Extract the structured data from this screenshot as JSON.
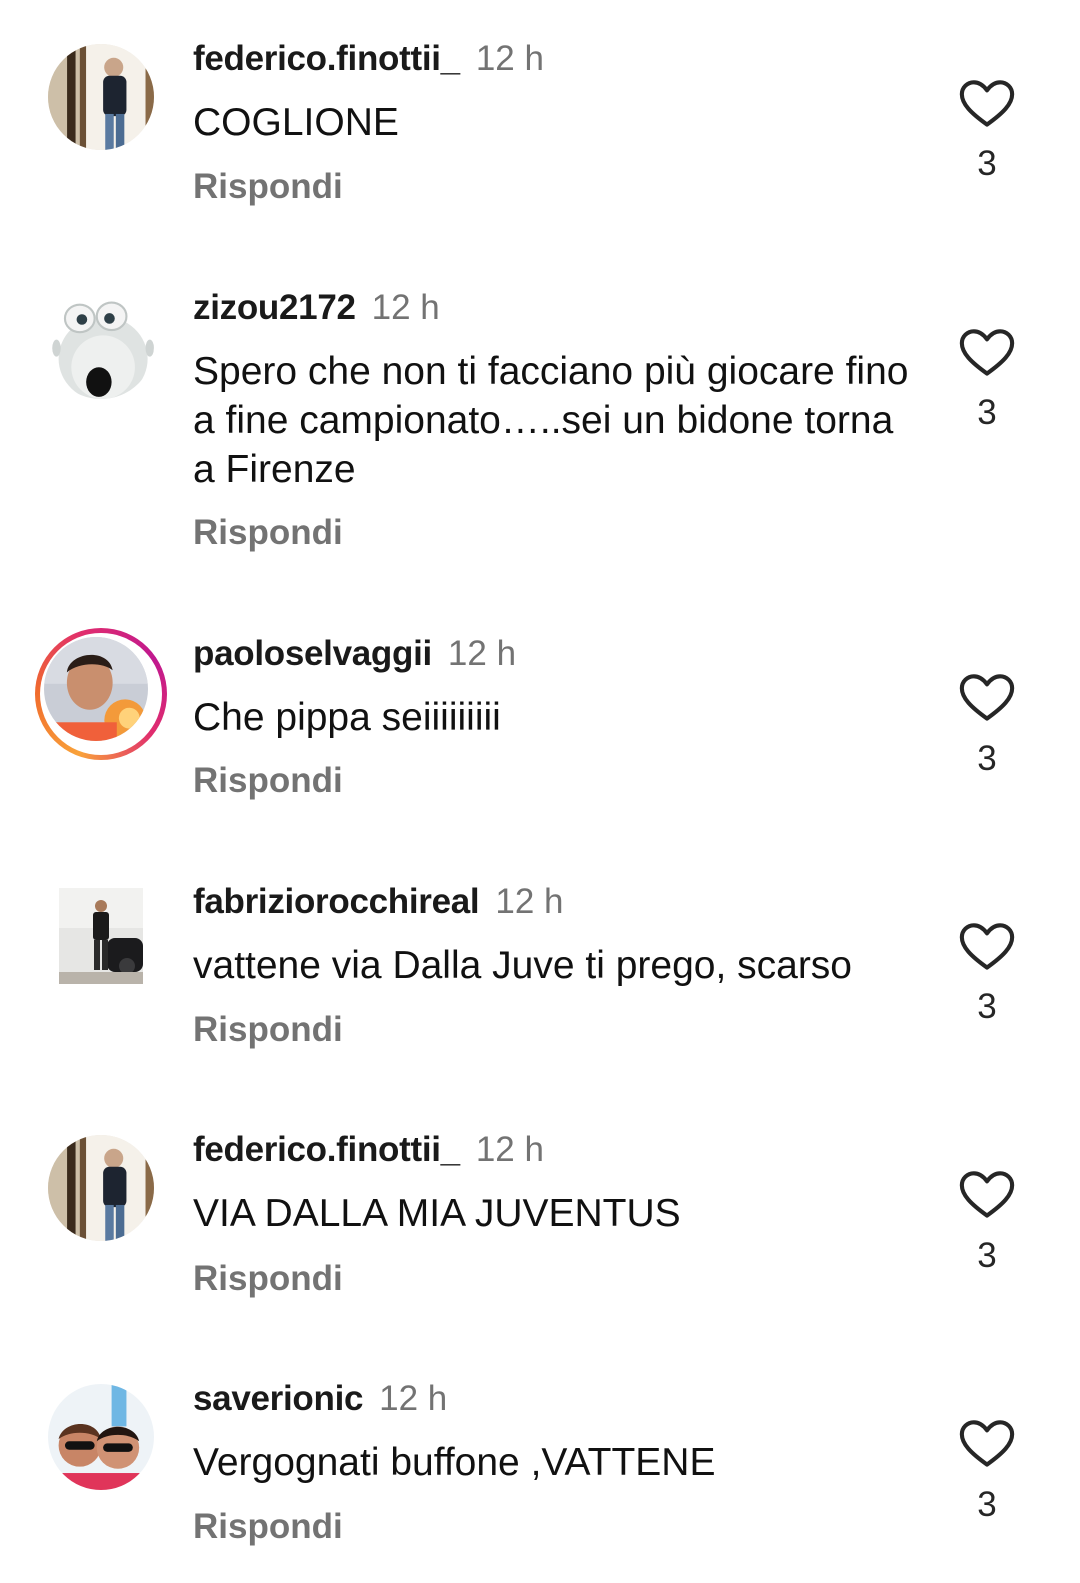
{
  "comments": [
    {
      "username": "federico.finottii_",
      "time": "12 h",
      "text": "COGLIONE",
      "reply_label": "Rispondi",
      "like_count": "3",
      "avatar": "person-in-doorway-photo",
      "has_story_ring": false
    },
    {
      "username": "zizou2172",
      "time": "12 h",
      "text": "Spero che non ti facciano più giocare fino a fine campionato…..sei un bidone torna a Firenze",
      "reply_label": "Rispondi",
      "like_count": "3",
      "avatar": "cartoon-bear-photo",
      "has_story_ring": false
    },
    {
      "username": "paoloselvaggii",
      "time": "12 h",
      "text": "Che pippa seiiiiiiiii",
      "reply_label": "Rispondi",
      "like_count": "3",
      "avatar": "selfie-sunset-photo",
      "has_story_ring": true
    },
    {
      "username": "fabriziorocchireal",
      "time": "12 h",
      "text": "vattene via Dalla Juve ti prego, scarso",
      "reply_label": "Rispondi",
      "like_count": "3",
      "avatar": "man-with-car-photo",
      "has_story_ring": false
    },
    {
      "username": "federico.finottii_",
      "time": "12 h",
      "text": "VIA DALLA MIA JUVENTUS",
      "reply_label": "Rispondi",
      "like_count": "3",
      "avatar": "person-in-doorway-photo",
      "has_story_ring": false
    },
    {
      "username": "saverionic",
      "time": "12 h",
      "text": "Vergognati buffone ,VATTENE",
      "reply_label": "Rispondi",
      "like_count": "3",
      "avatar": "couple-selfie-photo",
      "has_story_ring": false
    }
  ],
  "icons": {
    "like": "heart-outline-icon"
  },
  "colors": {
    "username": "#1a1a1a",
    "secondary_text": "#737373",
    "story_ring_start": "#f9a23a",
    "story_ring_end": "#c0188f"
  }
}
